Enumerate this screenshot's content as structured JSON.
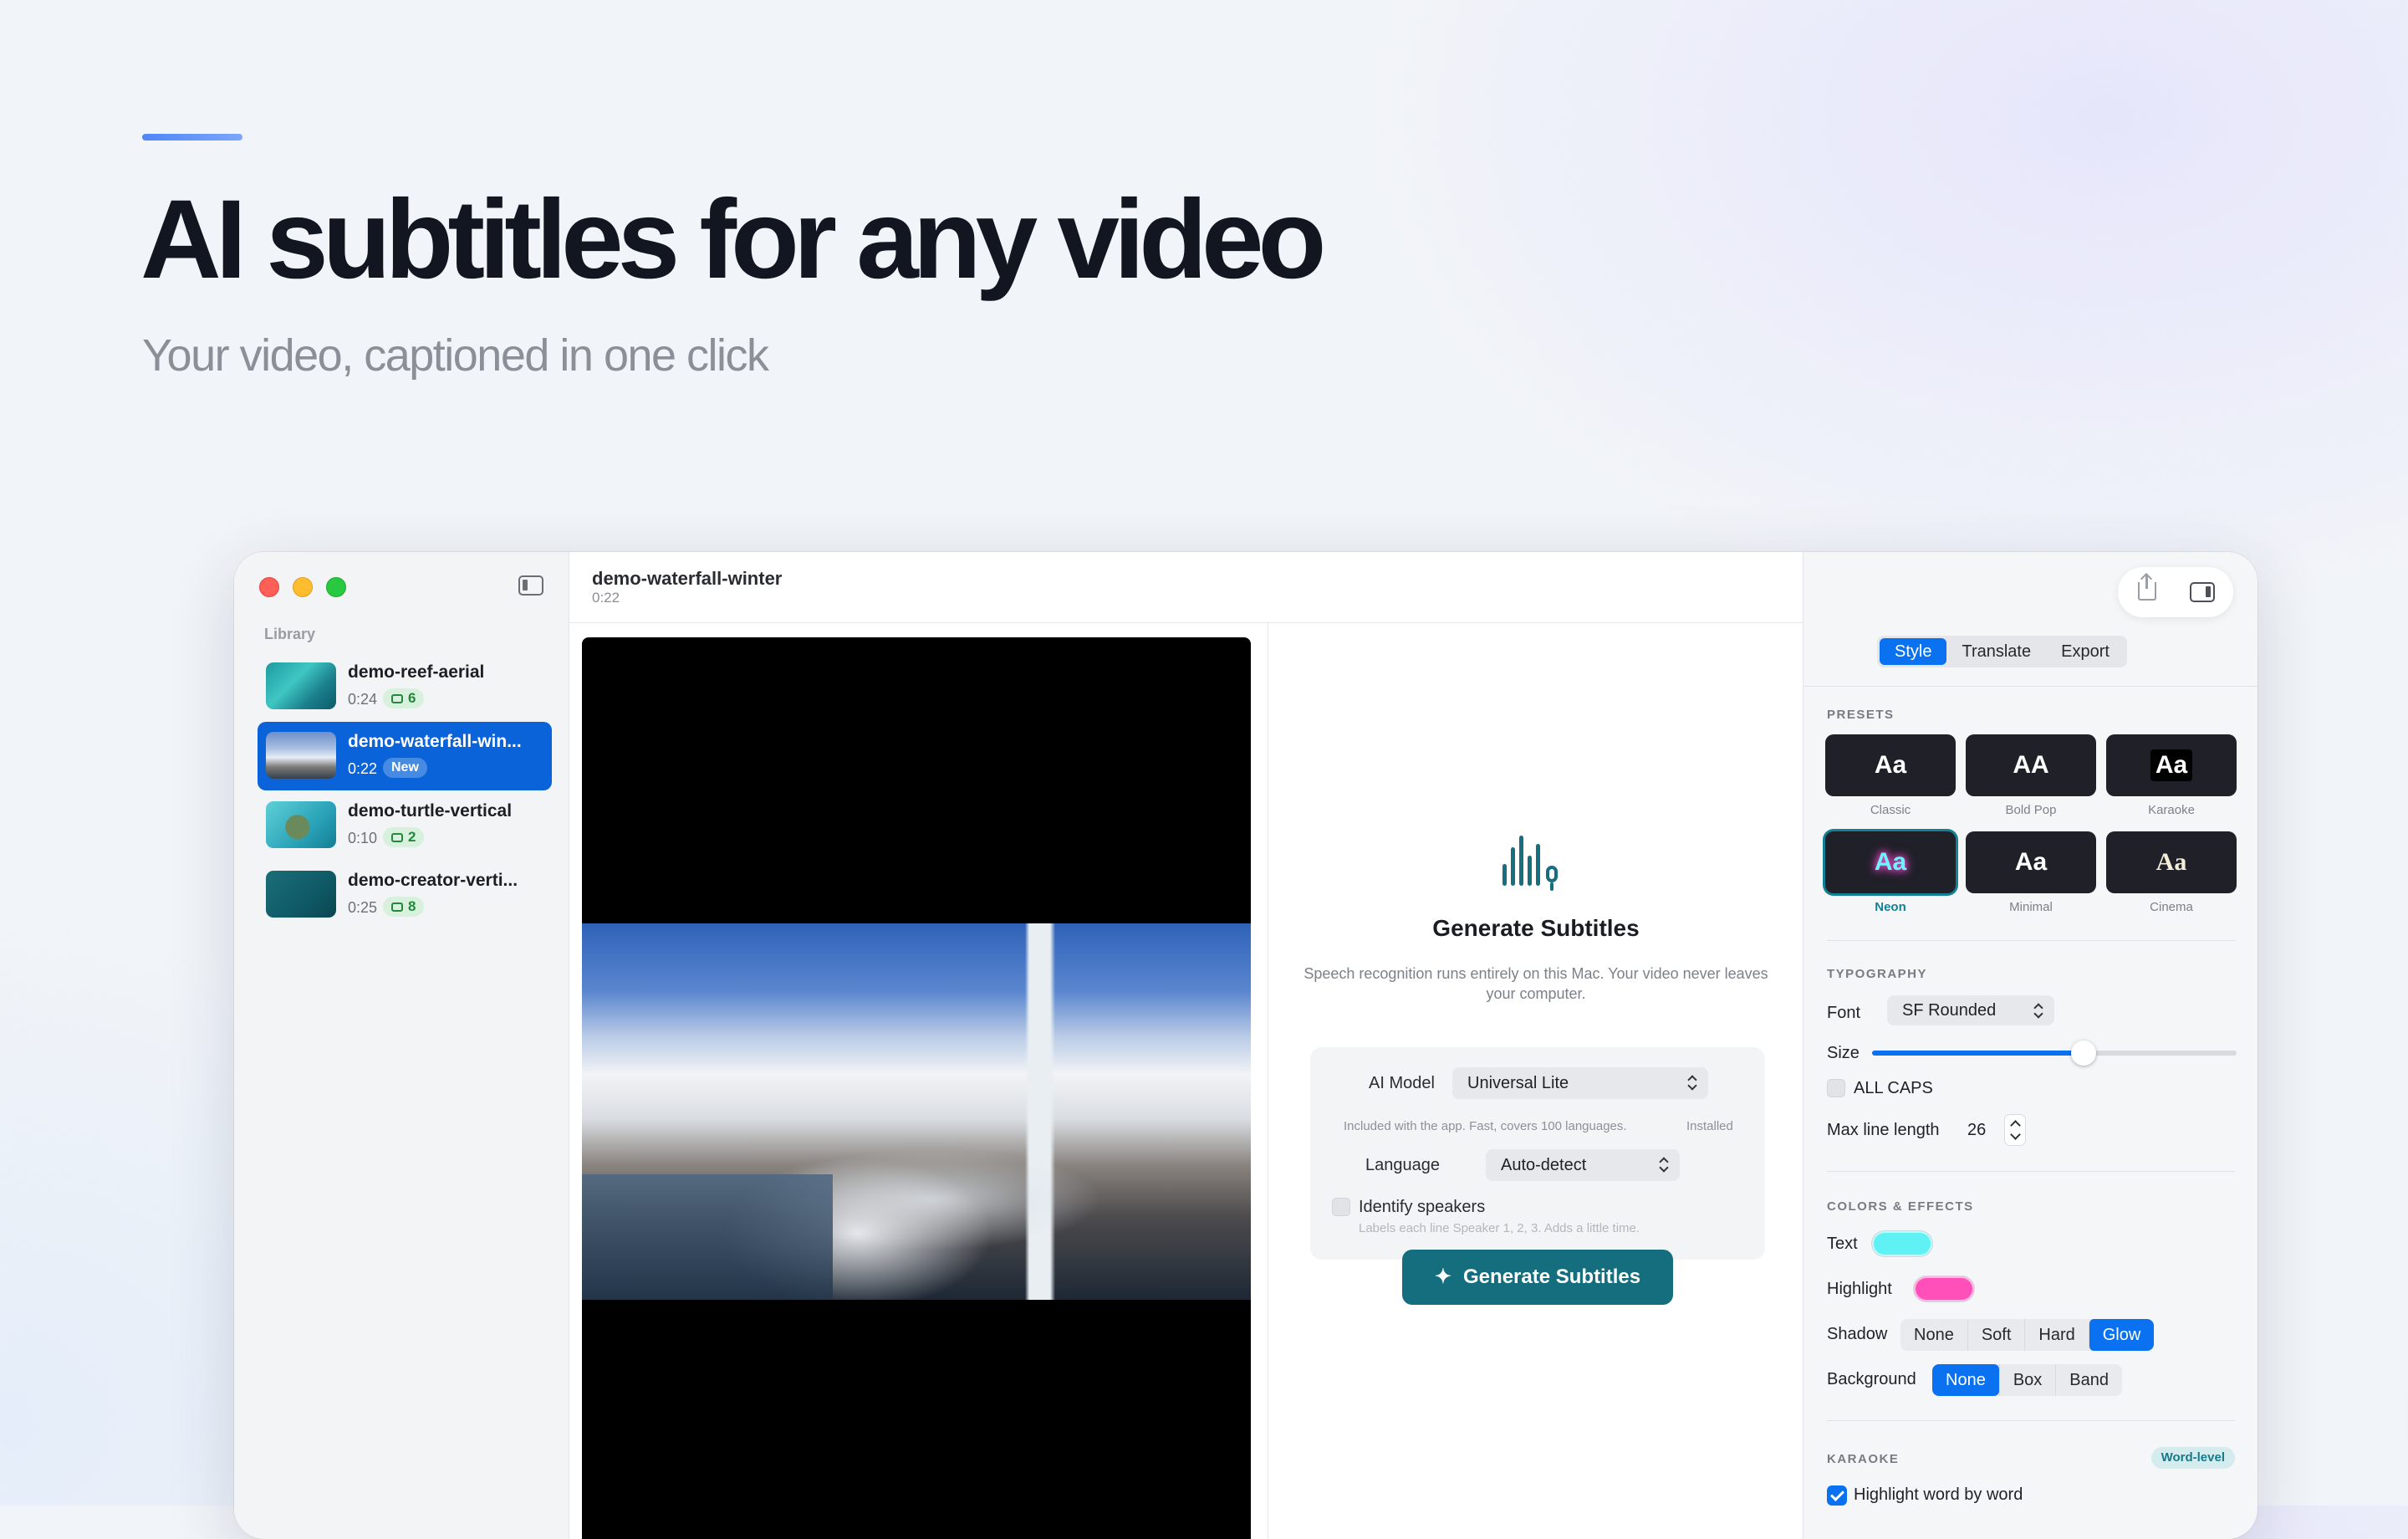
{
  "hero": {
    "title": "AI subtitles for any video",
    "subtitle": "Your video, captioned in one click"
  },
  "sidebar": {
    "section_label": "Library",
    "items": [
      {
        "name": "demo-reef-aerial",
        "duration": "0:24",
        "badge": "6"
      },
      {
        "name": "demo-waterfall-win...",
        "duration": "0:22",
        "badge": "New"
      },
      {
        "name": "demo-turtle-vertical",
        "duration": "0:10",
        "badge": "2"
      },
      {
        "name": "demo-creator-verti...",
        "duration": "0:25",
        "badge": "8"
      }
    ]
  },
  "document": {
    "title": "demo-waterfall-winter",
    "duration": "0:22"
  },
  "generate": {
    "title": "Generate Subtitles",
    "description": "Speech recognition runs entirely on this Mac. Your video never leaves your computer.",
    "model_label": "AI Model",
    "model_value": "Universal Lite",
    "model_note": "Included with the app. Fast, covers 100 languages.",
    "model_status": "Installed",
    "language_label": "Language",
    "language_value": "Auto-detect",
    "speakers_label": "Identify speakers",
    "speakers_note": "Labels each line Speaker 1, 2, 3. Adds a little time.",
    "button_label": "Generate Subtitles"
  },
  "inspector": {
    "tabs": [
      "Style",
      "Translate",
      "Export"
    ],
    "active_tab": "Style",
    "presets_label": "PRESETS",
    "presets": [
      {
        "sample": "Aa",
        "name": "Classic"
      },
      {
        "sample": "AA",
        "name": "Bold Pop"
      },
      {
        "sample": "Aa",
        "name": "Karaoke"
      },
      {
        "sample": "Aa",
        "name": "Neon"
      },
      {
        "sample": "Aa",
        "name": "Minimal"
      },
      {
        "sample": "Aa",
        "name": "Cinema"
      }
    ],
    "selected_preset": "Neon",
    "typography_label": "TYPOGRAPHY",
    "font_label": "Font",
    "font_value": "SF Rounded",
    "size_label": "Size",
    "size_fraction": 0.58,
    "allcaps_label": "ALL CAPS",
    "maxline_label": "Max line length",
    "maxline_value": "26",
    "colors_label": "COLORS & EFFECTS",
    "text_label": "Text",
    "text_color": "#5ff1f4",
    "highlight_label": "Highlight",
    "highlight_color": "#ff4fb8",
    "shadow_label": "Shadow",
    "shadow_options": [
      "None",
      "Soft",
      "Hard",
      "Glow"
    ],
    "shadow_selected": "Glow",
    "background_label": "Background",
    "background_options": [
      "None",
      "Box",
      "Band"
    ],
    "background_selected": "None",
    "karaoke_label": "KARAOKE",
    "karaoke_badge": "Word-level",
    "highlight_word_label": "Highlight word by word"
  },
  "icons": [
    "sidebar-toggle-icon",
    "share-icon",
    "inspector-panel-icon",
    "waveform-mic-icon",
    "sparkle-icon",
    "subtitle-badge-icon",
    "chevron-updown-icon"
  ],
  "colors": {
    "accent": "#0a72f0",
    "brand": "#146e7e",
    "selection": "#0a63d9"
  }
}
